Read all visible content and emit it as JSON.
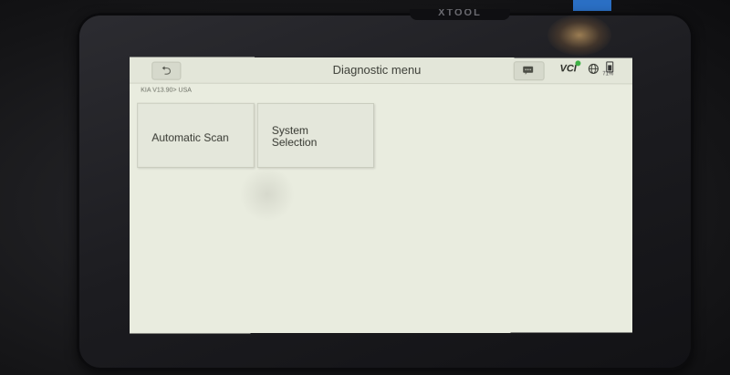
{
  "device": {
    "brand_label": "XTOOL"
  },
  "header": {
    "title": "Diagnostic menu",
    "back_glyph": "⮌",
    "vci_label": "VCI",
    "battery_percent": "71%",
    "battery_level": 0.71
  },
  "breadcrumb": {
    "text": "KIA V13.90> USA"
  },
  "menu": {
    "items": [
      {
        "label": "Automatic Scan"
      },
      {
        "label": "System Selection"
      }
    ]
  },
  "colors": {
    "screen_bg": "#e9ecdf",
    "vci_status": "#3cb043",
    "accent_tab": "#2a6fc4"
  },
  "icons": {
    "back": "back-arrow-icon",
    "message": "message-icon",
    "vci": "vci-icon",
    "network": "globe-icon",
    "battery": "battery-icon"
  }
}
